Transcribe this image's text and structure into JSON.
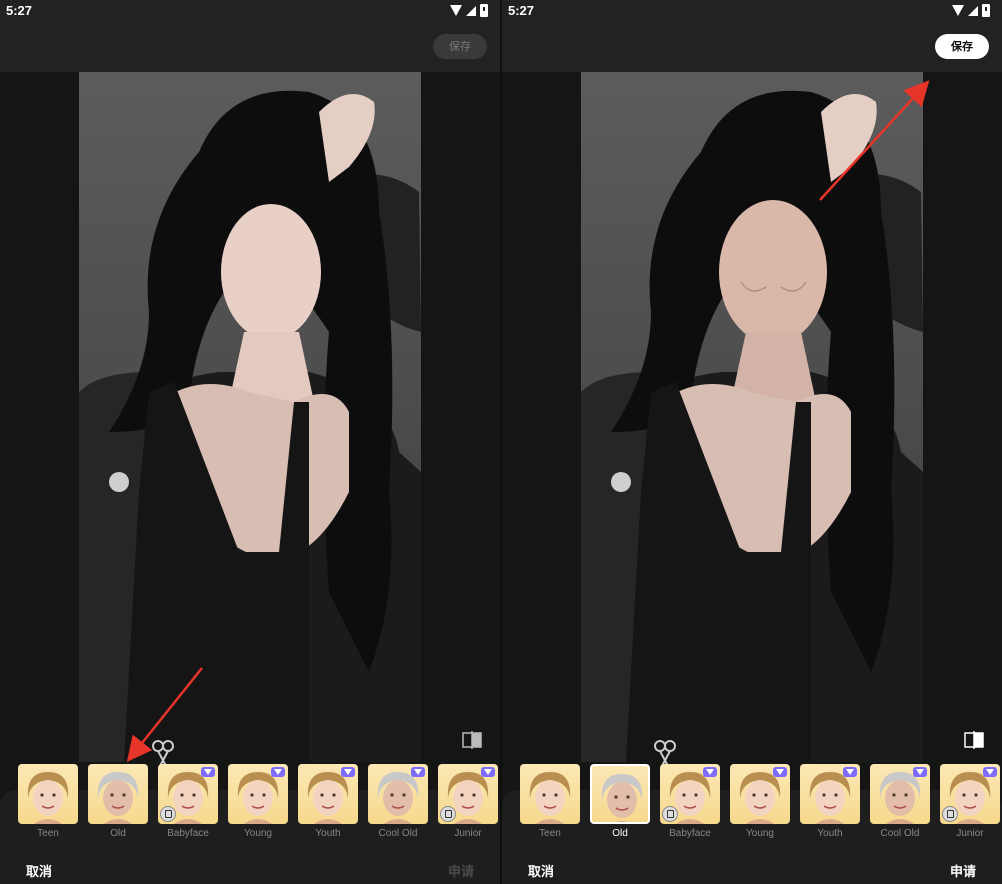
{
  "panels": [
    {
      "id": "before",
      "status": {
        "time": "5:27"
      },
      "save_label": "保存",
      "save_enabled": false,
      "cancel_label": "取消",
      "apply_label": "申请",
      "apply_enabled": false,
      "selected_filter": null,
      "filters": [
        {
          "label": "Teen",
          "premium": false,
          "ad": false
        },
        {
          "label": "Old",
          "premium": false,
          "ad": false
        },
        {
          "label": "Babyface",
          "premium": true,
          "ad": true
        },
        {
          "label": "Young",
          "premium": true,
          "ad": false
        },
        {
          "label": "Youth",
          "premium": true,
          "ad": false
        },
        {
          "label": "Cool Old",
          "premium": true,
          "ad": false
        },
        {
          "label": "Junior",
          "premium": true,
          "ad": true
        }
      ]
    },
    {
      "id": "after",
      "status": {
        "time": "5:27"
      },
      "save_label": "保存",
      "save_enabled": true,
      "cancel_label": "取消",
      "apply_label": "申请",
      "apply_enabled": true,
      "selected_filter": "Old",
      "filters": [
        {
          "label": "Teen",
          "premium": false,
          "ad": false
        },
        {
          "label": "Old",
          "premium": false,
          "ad": false
        },
        {
          "label": "Babyface",
          "premium": true,
          "ad": true
        },
        {
          "label": "Young",
          "premium": true,
          "ad": false
        },
        {
          "label": "Youth",
          "premium": true,
          "ad": false
        },
        {
          "label": "Cool Old",
          "premium": true,
          "ad": false
        },
        {
          "label": "Junior",
          "premium": true,
          "ad": true
        }
      ]
    }
  ],
  "icons": {
    "status": [
      "wifi-icon",
      "signal-icon",
      "battery-icon"
    ],
    "compare": "compare-icon",
    "tools": "edit-tools-icon",
    "premium": "diamond-icon",
    "ad": "ad-icon"
  },
  "colors": {
    "background": "#151515",
    "topbar": "#222222",
    "premium_badge": "#7d6bff",
    "annotation_arrow": "#e8352a",
    "thumb_bg": "#f7d98d"
  }
}
